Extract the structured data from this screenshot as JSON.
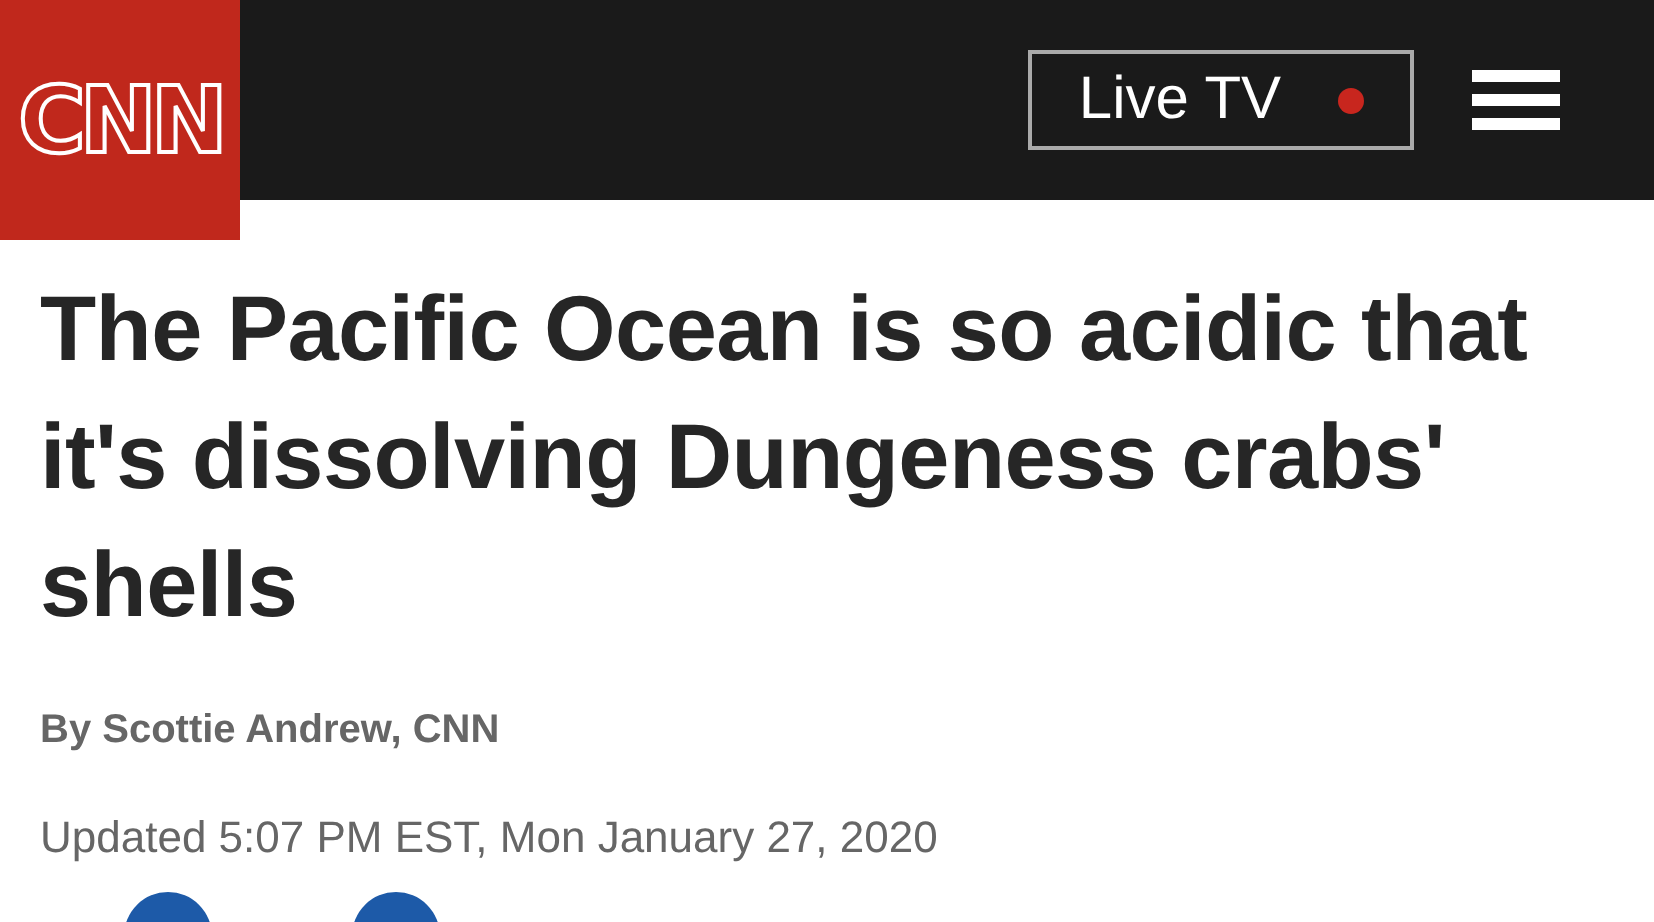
{
  "header": {
    "logo": "CNN",
    "live_button": "Live TV"
  },
  "article": {
    "headline": "The Pacific Ocean is so acidic that it's dissolving Dungeness crabs' shells",
    "byline": "By Scottie Andrew, CNN",
    "updated": "Updated 5:07 PM EST, Mon January 27, 2020"
  }
}
